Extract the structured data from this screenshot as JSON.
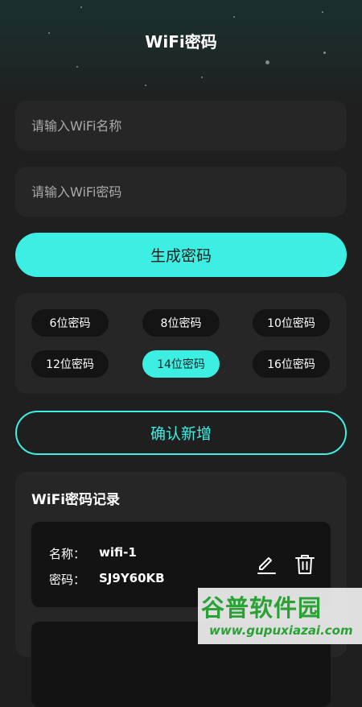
{
  "header": {
    "title": "WiFi密码"
  },
  "form": {
    "name_placeholder": "请输入WiFi名称",
    "password_placeholder": "请输入WiFi密码",
    "generate_label": "生成密码",
    "confirm_label": "确认新增"
  },
  "lengths": {
    "options": [
      "6位密码",
      "8位密码",
      "10位密码",
      "12位密码",
      "14位密码",
      "16位密码"
    ],
    "selected": "14位密码"
  },
  "records": {
    "title": "WiFi密码记录",
    "items": [
      {
        "name_label": "名称：",
        "name": "wifi-1",
        "password_label": "密码：",
        "password": "SJ9Y60KB"
      }
    ]
  },
  "watermark": {
    "title": "谷普软件园",
    "url": "www.gupuxiazai.com"
  },
  "colors": {
    "accent": "#3cefe2",
    "background": "#1f1f1f",
    "panel": "#262626",
    "watermark": "#2aa135"
  },
  "icons": {
    "edit": "pencil-icon",
    "delete": "trash-icon"
  }
}
